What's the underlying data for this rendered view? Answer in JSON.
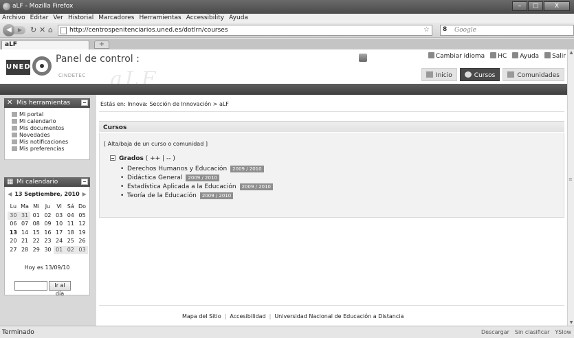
{
  "browser": {
    "window_title": "aLF - Mozilla Firefox",
    "window_buttons": [
      "–",
      "□",
      "X"
    ],
    "menu": [
      "Archivo",
      "Editar",
      "Ver",
      "Historial",
      "Marcadores",
      "Herramientas",
      "Accessibility",
      "Ayuda"
    ],
    "url": "http://centrospenitenciarios.uned.es/dotlrn/courses",
    "search_placeholder": "Google",
    "search_engine_label": "8",
    "tab_title": "aLF",
    "new_tab": "+",
    "status": "Terminado",
    "status_right": [
      "Descargar",
      "Sin clasificar",
      "YSlow"
    ]
  },
  "header": {
    "logo_text": "UNED",
    "title": "Panel de control :",
    "subtitle": "CINDETEC",
    "watermark": "aLF",
    "top_links": [
      "Cambiar idioma",
      "HC",
      "Ayuda",
      "Salir"
    ],
    "nav_tabs": [
      {
        "label": "Inicio",
        "active": false
      },
      {
        "label": "Cursos",
        "active": true
      },
      {
        "label": "Comunidades",
        "active": false
      }
    ]
  },
  "sidebar": {
    "tools_title": "Mis herramientas",
    "tools": [
      "Mi portal",
      "Mi calendario",
      "Mis documentos",
      "Novedades",
      "Mis notificaciones",
      "Mis preferencias"
    ],
    "calendar_title": "Mi calendario",
    "calendar": {
      "current": "13 Septiembre, 2010",
      "weekdays": [
        "Lu",
        "Ma",
        "Mi",
        "Ju",
        "Vi",
        "Sá",
        "Do"
      ],
      "weeks": [
        [
          "30",
          "31",
          "01",
          "02",
          "03",
          "04",
          "05"
        ],
        [
          "06",
          "07",
          "08",
          "09",
          "10",
          "11",
          "12"
        ],
        [
          "13",
          "14",
          "15",
          "16",
          "17",
          "18",
          "19"
        ],
        [
          "20",
          "21",
          "22",
          "23",
          "24",
          "25",
          "26"
        ],
        [
          "27",
          "28",
          "29",
          "30",
          "01",
          "02",
          "03"
        ]
      ],
      "today_text": "Hoy es 13/09/10",
      "go_button": "Ir al día"
    }
  },
  "main": {
    "breadcrumb": "Estás en: Innova: Sección de Innovación > aLF",
    "section_title": "Cursos",
    "alta_link": "[ Alta/baja de un curso o comunidad ]",
    "group_label": "Grados",
    "group_controls": "( ++ | -- )",
    "courses": [
      {
        "name": "Derechos Humanos y Educación",
        "term": "2009 / 2010"
      },
      {
        "name": "Didáctica General",
        "term": "2009 / 2010"
      },
      {
        "name": "Estadística Aplicada a la Educación",
        "term": "2009 / 2010"
      },
      {
        "name": "Teoría de la Educación",
        "term": "2009 / 2010"
      }
    ]
  },
  "footer": {
    "links": [
      "Mapa del Sitio",
      "Accesibilidad",
      "Universidad Nacional de Educación a Distancia"
    ],
    "separator": "|"
  }
}
